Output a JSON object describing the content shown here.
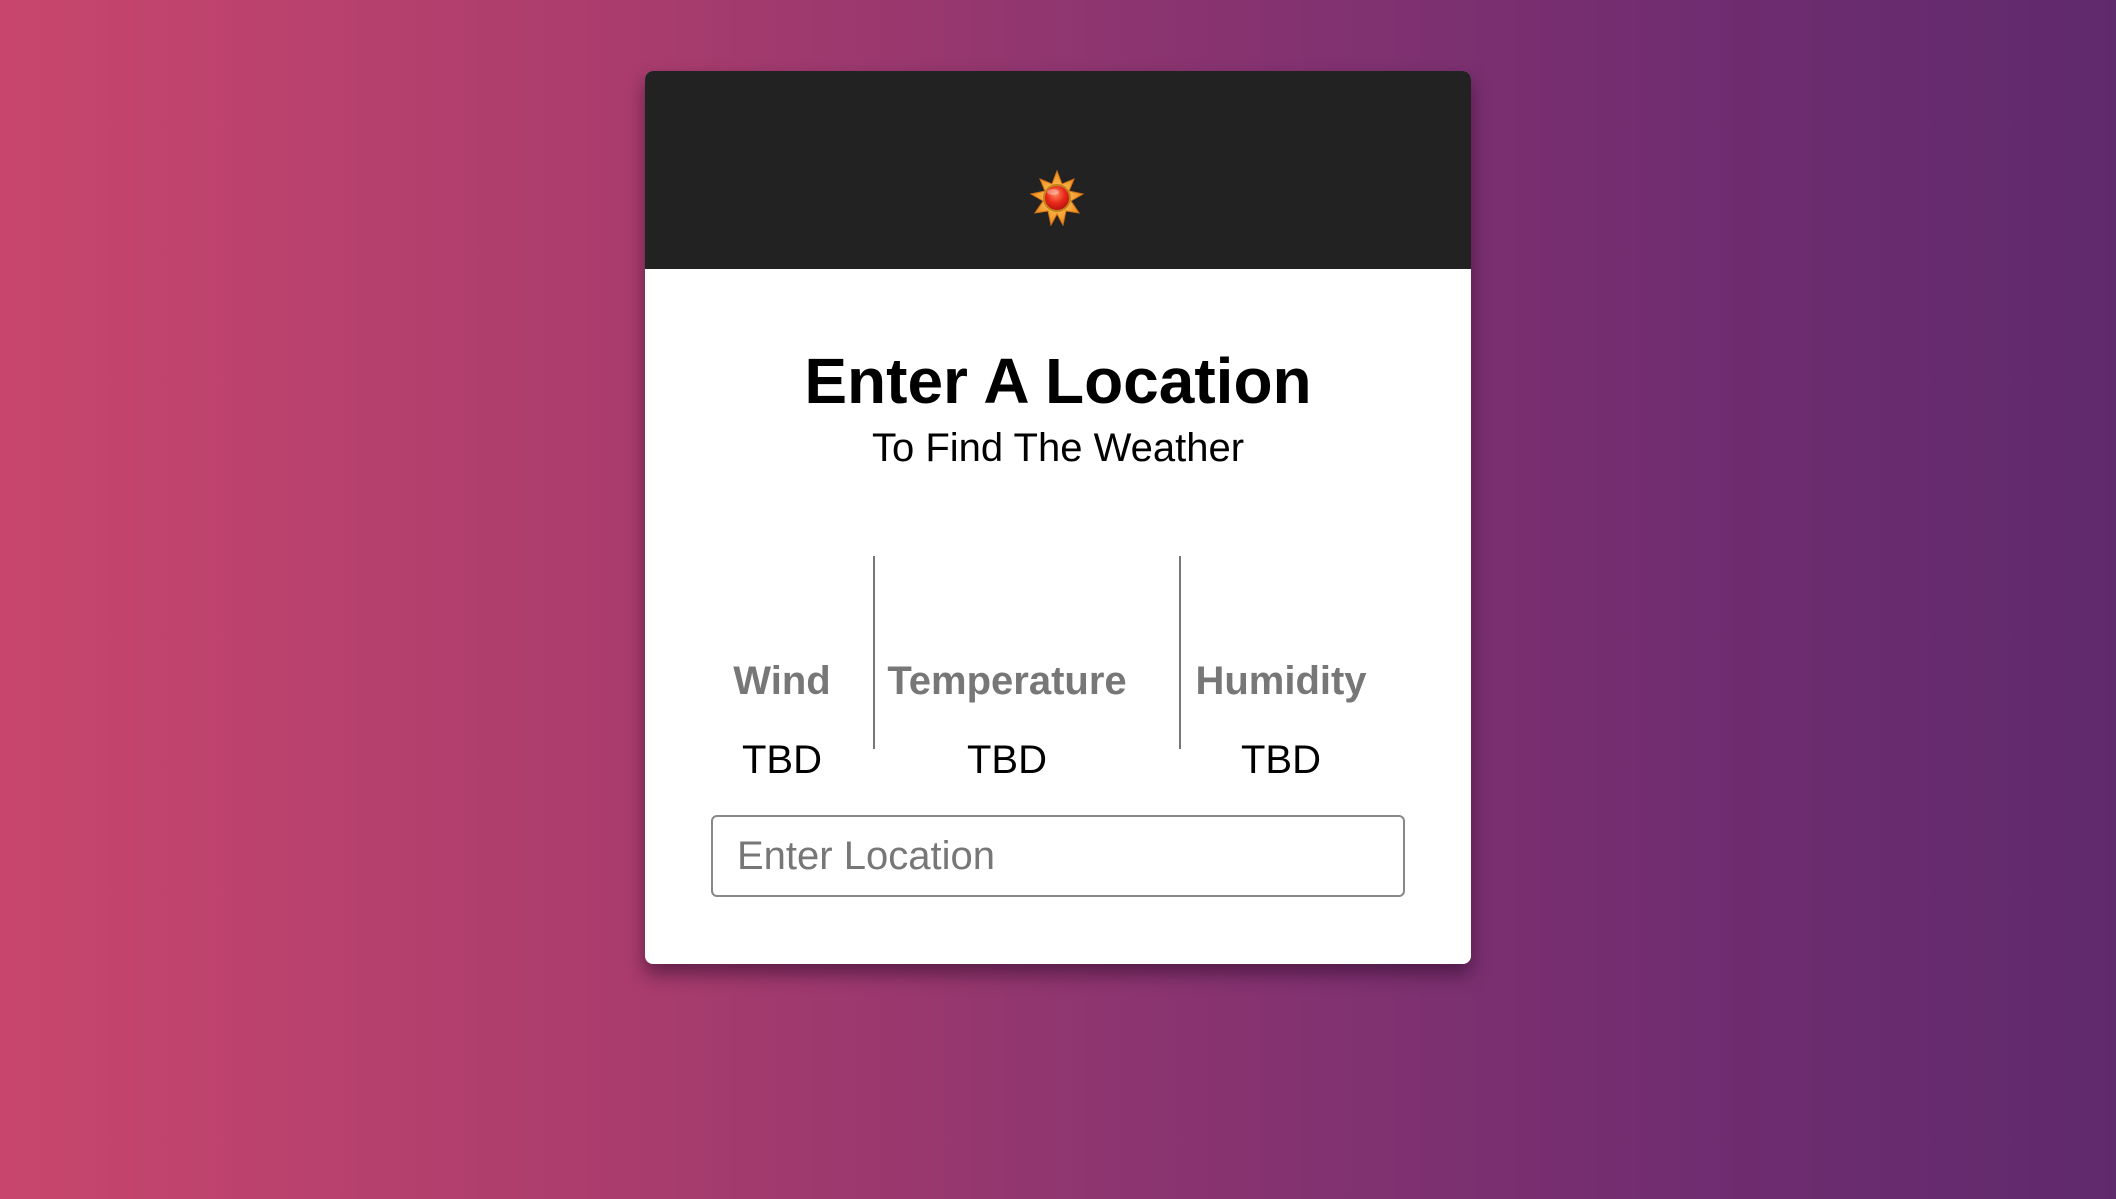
{
  "header": {
    "icon": "sun-icon"
  },
  "main": {
    "title": "Enter A Location",
    "subtitle": "To Find The Weather"
  },
  "stats": [
    {
      "label": "Wind",
      "value": "TBD"
    },
    {
      "label": "Temperature",
      "value": "TBD"
    },
    {
      "label": "Humidity",
      "value": "TBD"
    }
  ],
  "search": {
    "value": "",
    "placeholder": "Enter Location"
  },
  "colors": {
    "header_bg": "#222222",
    "label_gray": "#777777",
    "gradient_start": "#c8466d",
    "gradient_end": "#5f2a6c",
    "sun_core": "#e8261a",
    "sun_rays": "#f4a42a"
  }
}
